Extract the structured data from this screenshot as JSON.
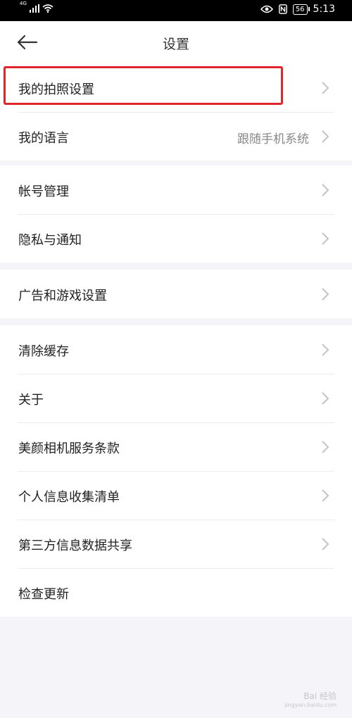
{
  "status_bar": {
    "network": "4G",
    "battery": "56",
    "time": "5:13"
  },
  "header": {
    "title": "设置"
  },
  "sections": [
    {
      "items": [
        {
          "label": "我的拍照设置",
          "value": "",
          "chevron": true,
          "highlighted": true
        },
        {
          "label": "我的语言",
          "value": "跟随手机系统",
          "chevron": true
        }
      ]
    },
    {
      "items": [
        {
          "label": "帐号管理",
          "value": "",
          "chevron": true
        },
        {
          "label": "隐私与通知",
          "value": "",
          "chevron": true
        }
      ]
    },
    {
      "items": [
        {
          "label": "广告和游戏设置",
          "value": "",
          "chevron": true
        }
      ]
    },
    {
      "items": [
        {
          "label": "清除缓存",
          "value": "",
          "chevron": true
        },
        {
          "label": "关于",
          "value": "",
          "chevron": true
        },
        {
          "label": "美颜相机服务条款",
          "value": "",
          "chevron": true
        },
        {
          "label": "个人信息收集清单",
          "value": "",
          "chevron": true
        },
        {
          "label": "第三方信息数据共享",
          "value": "",
          "chevron": true
        },
        {
          "label": "检查更新",
          "value": "",
          "chevron": false
        }
      ]
    }
  ],
  "watermark": {
    "text": "Bai 经验",
    "sub": "jingyan.baidu.com"
  },
  "colors": {
    "highlight": "#e0262d",
    "background": "#f5f5f9",
    "chevron": "#c4c4c4"
  }
}
